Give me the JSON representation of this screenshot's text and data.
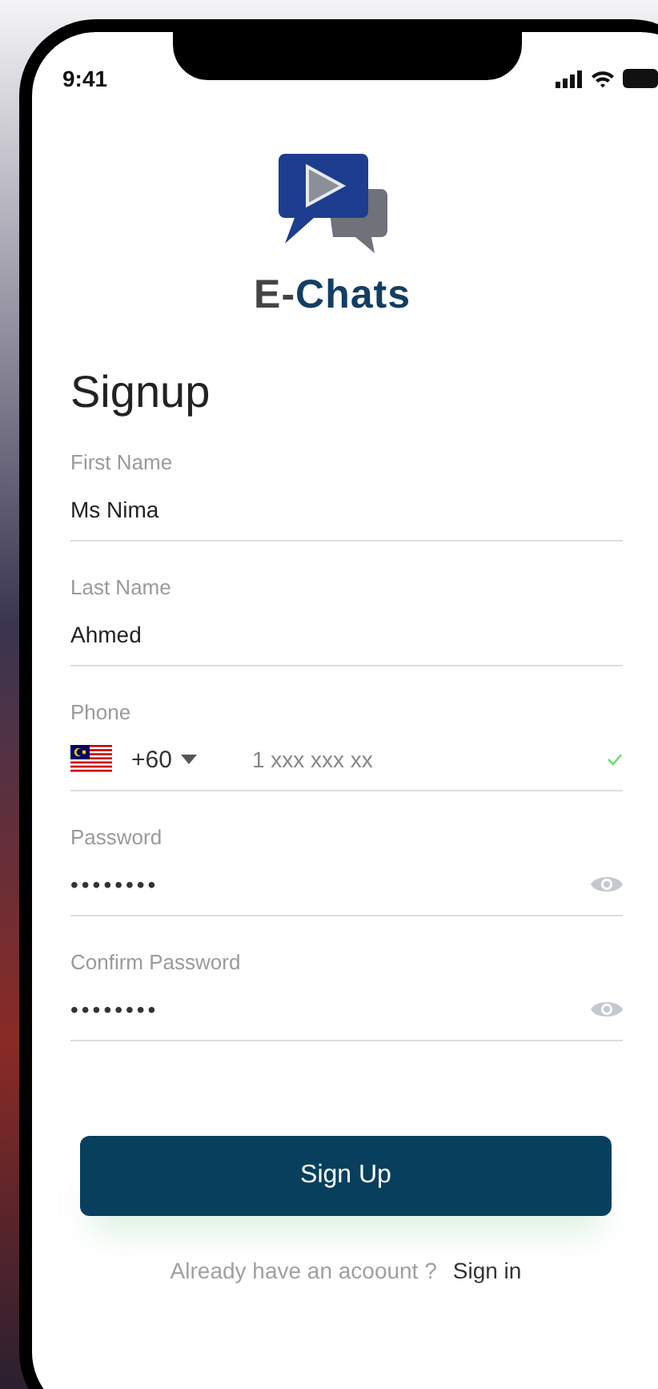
{
  "status_bar": {
    "time": "9:41"
  },
  "brand": {
    "prefix": "E-",
    "name": "Chats"
  },
  "title": "Signup",
  "fields": [
    {
      "kind": "text",
      "label": "First Name",
      "value": "Ms Nima"
    },
    {
      "kind": "text",
      "label": "Last Name",
      "value": "Ahmed"
    },
    {
      "kind": "phone",
      "label": "Phone",
      "country_code": "+60",
      "placeholder": "1 xxx xxx xx",
      "verified": true
    },
    {
      "kind": "password",
      "label": "Password",
      "value": "••••••••"
    },
    {
      "kind": "password",
      "label": "Confirm Password",
      "value": "••••••••"
    }
  ],
  "submit": "Sign Up",
  "footer": {
    "prompt": "Already have an acoount ?",
    "link": "Sign in"
  }
}
